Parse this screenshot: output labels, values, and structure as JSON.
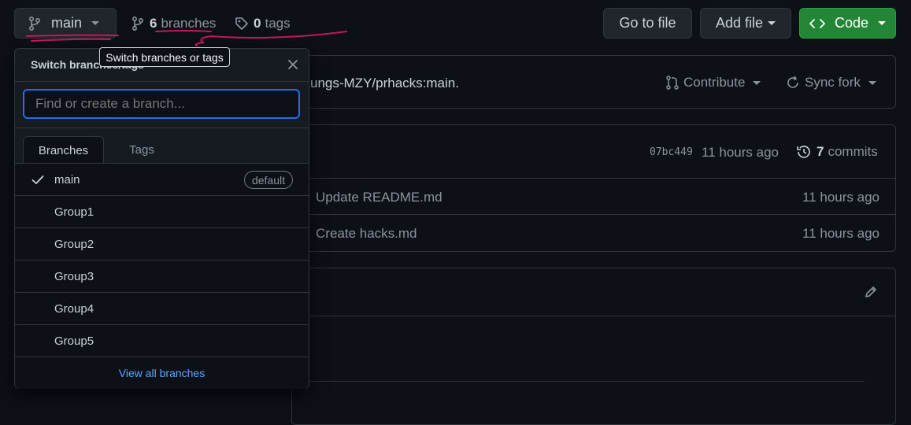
{
  "topbar": {
    "branch_button": "main",
    "branches_count": "6",
    "branches_label": "branches",
    "tags_count": "0",
    "tags_label": "tags",
    "go_to_file": "Go to file",
    "add_file": "Add file",
    "code": "Code"
  },
  "fork_bar": {
    "text": "ungs-MZY/prhacks:main.",
    "contribute": "Contribute",
    "sync_fork": "Sync fork"
  },
  "commit_bar": {
    "hash": "07bc449",
    "time": "11 hours ago",
    "commits_count": "7",
    "commits_label": "commits"
  },
  "files": [
    {
      "message": "Update README.md",
      "time": "11 hours ago"
    },
    {
      "message": "Create hacks.md",
      "time": "11 hours ago"
    }
  ],
  "dropdown": {
    "title": "Switch branches/tags",
    "search_placeholder": "Find or create a branch...",
    "tabs": [
      "Branches",
      "Tags"
    ],
    "branches": [
      {
        "name": "main",
        "badge": "default"
      },
      {
        "name": "Group1"
      },
      {
        "name": "Group2"
      },
      {
        "name": "Group3"
      },
      {
        "name": "Group4"
      },
      {
        "name": "Group5"
      }
    ],
    "view_all": "View all branches"
  },
  "tooltip": "Switch branches or tags",
  "colors": {
    "background": "#0d1117",
    "border": "#30363d",
    "accent_blue": "#58a6ff",
    "code_green": "#238636",
    "annotation_pink": "#c2185b"
  }
}
